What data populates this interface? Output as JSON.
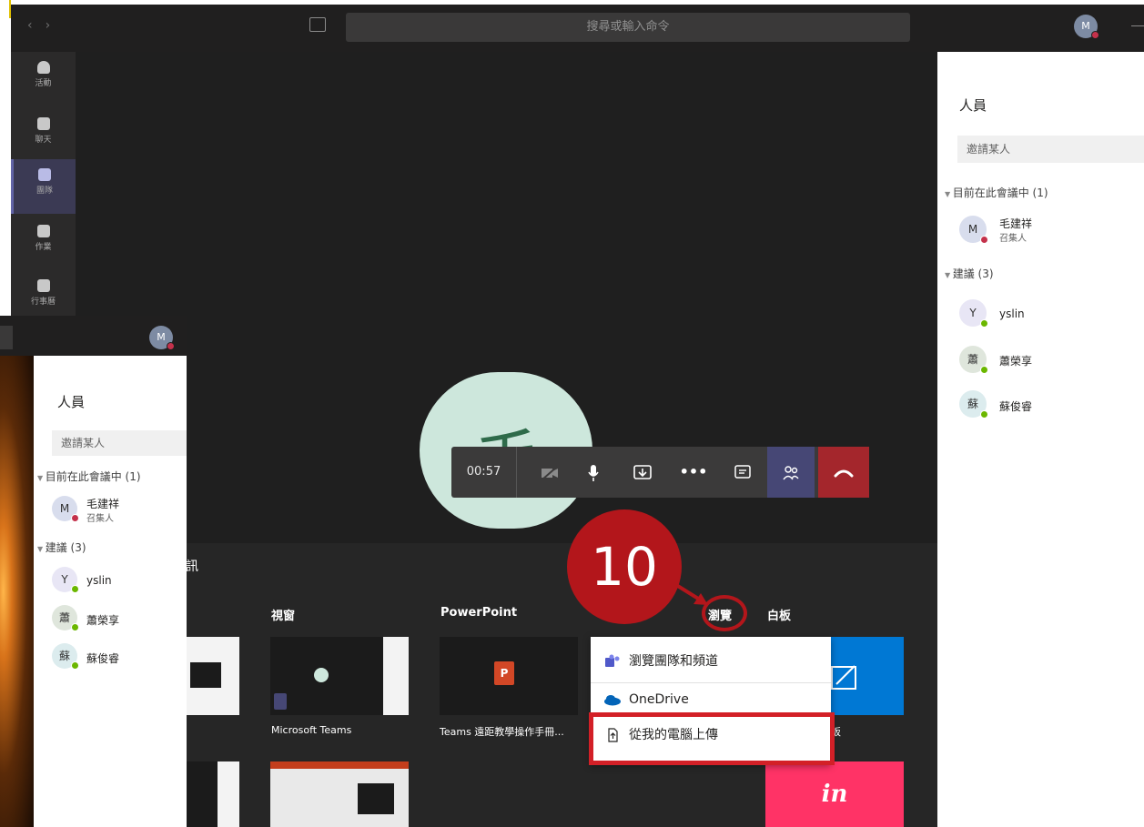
{
  "titlebar": {
    "nav_back": "‹",
    "nav_forward": "›",
    "search_placeholder": "搜尋或輸入命令",
    "avatar_initial": "M"
  },
  "rail": {
    "items": [
      {
        "label": "活動",
        "icon": "bell-icon"
      },
      {
        "label": "聊天",
        "icon": "chat-icon"
      },
      {
        "label": "團隊",
        "icon": "teams-icon"
      },
      {
        "label": "作業",
        "icon": "assignment-icon"
      },
      {
        "label": "行事曆",
        "icon": "calendar-icon"
      }
    ],
    "active_index": 2
  },
  "meeting": {
    "avatar_char": "毛",
    "callbar": {
      "time": "00:57",
      "buttons": [
        "camera-off-icon",
        "mic-icon",
        "share-tray-icon",
        "more-icon",
        "chat-icon",
        "participants-icon",
        "hangup-icon"
      ]
    }
  },
  "share_tray": {
    "section_label": "音訊",
    "columns": {
      "window": "視窗",
      "powerpoint": "PowerPoint",
      "browse": "瀏覽",
      "whiteboard": "白板"
    },
    "window_caption": "Microsoft Teams",
    "ppt_caption": "Teams 遠距教學操作手冊...",
    "whiteboard_caption_fragment": "板",
    "invision_text": "in",
    "browse_menu": [
      {
        "label": "瀏覽團隊和頻道",
        "icon": "teams-logo-icon"
      },
      {
        "label": "OneDrive",
        "icon": "onedrive-cloud-icon"
      },
      {
        "label": "從我的電腦上傳",
        "icon": "upload-file-icon"
      }
    ]
  },
  "annotation": {
    "step_number": "10",
    "color": "#b3161b"
  },
  "people_panel": {
    "title": "人員",
    "invite_placeholder": "邀請某人",
    "in_meeting_header": "目前在此會議中 (1)",
    "organizer": {
      "initial": "M",
      "name": "毛建祥",
      "role": "召集人"
    },
    "suggested_header": "建議 (3)",
    "suggested": [
      {
        "initial": "Y",
        "name": "yslin",
        "avatar_bg": "#e8e6f5"
      },
      {
        "initial": "蕭",
        "name": "蕭榮享",
        "avatar_bg": "#dfe6dc"
      },
      {
        "initial": "蘇",
        "name": "蘇俊睿",
        "avatar_bg": "#dcecee"
      }
    ]
  }
}
